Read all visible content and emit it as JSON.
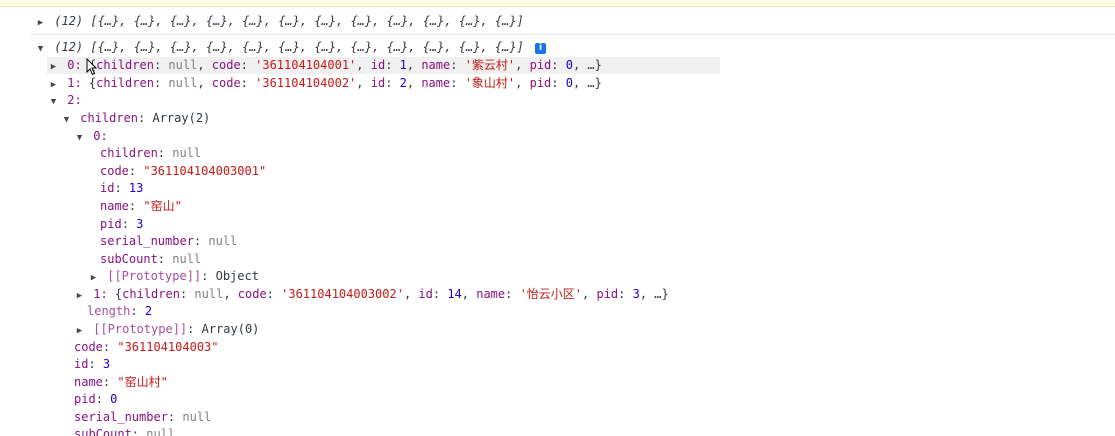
{
  "rows": {
    "r0": {
      "summary": "(12) [{…}, {…}, {…}, {…}, {…}, {…}, {…}, {…}, {…}, {…}, {…}, {…}]"
    },
    "r1": {
      "summary": "(12) [{…}, {…}, {…}, {…}, {…}, {…}, {…}, {…}, {…}, {…}, {…}, {…}]",
      "info": "i"
    },
    "r2": {
      "idx": "0:",
      "t1": "{",
      "k1": "children",
      "v1": "null",
      "k2": "code",
      "v2": "'361104104001'",
      "k3": "id",
      "v3": "1",
      "k4": "name",
      "v4": "'紫云村'",
      "k5": "pid",
      "v5": "0",
      "tail": ", …}"
    },
    "r3": {
      "idx": "1:",
      "t1": "{",
      "k1": "children",
      "v1": "null",
      "k2": "code",
      "v2": "'361104104002'",
      "k3": "id",
      "v3": "2",
      "k4": "name",
      "v4": "'象山村'",
      "k5": "pid",
      "v5": "0",
      "tail": ", …}"
    },
    "r4": {
      "idx": "2:"
    },
    "r5": {
      "key": "children",
      "val": "Array(2)"
    },
    "r6": {
      "idx": "0:"
    },
    "r7": {
      "key": "children",
      "val": "null"
    },
    "r8": {
      "key": "code",
      "val": "\"361104104003001\""
    },
    "r9": {
      "key": "id",
      "val": "13"
    },
    "r10": {
      "key": "name",
      "val": "\"窑山\""
    },
    "r11": {
      "key": "pid",
      "val": "3"
    },
    "r12": {
      "key": "serial_number",
      "val": "null"
    },
    "r13": {
      "key": "subCount",
      "val": "null"
    },
    "r14": {
      "key": "[[Prototype]]",
      "val": "Object"
    },
    "r15": {
      "idx": "1:",
      "t1": "{",
      "k1": "children",
      "v1": "null",
      "k2": "code",
      "v2": "'361104104003002'",
      "k3": "id",
      "v3": "14",
      "k4": "name",
      "v4": "'怡云小区'",
      "k5": "pid",
      "v5": "3",
      "tail": ", …}"
    },
    "r16": {
      "key": "length",
      "val": "2"
    },
    "r17": {
      "key": "[[Prototype]]",
      "val": "Array(0)"
    },
    "r18": {
      "key": "code",
      "val": "\"361104104003\""
    },
    "r19": {
      "key": "id",
      "val": "3"
    },
    "r20": {
      "key": "name",
      "val": "\"窑山村\""
    },
    "r21": {
      "key": "pid",
      "val": "0"
    },
    "r22": {
      "key": "serial_number",
      "val": "null"
    },
    "r23": {
      "key": "subCount",
      "val": "null"
    }
  },
  "glyphs": {
    "collapsed": "▶",
    "expanded": "▼",
    "colon": ": ",
    "comma": ", "
  },
  "colors": {
    "key": "#881280",
    "string": "#c41a16",
    "number": "#1c00cf",
    "null": "#808080",
    "info": "#1a73e8"
  }
}
